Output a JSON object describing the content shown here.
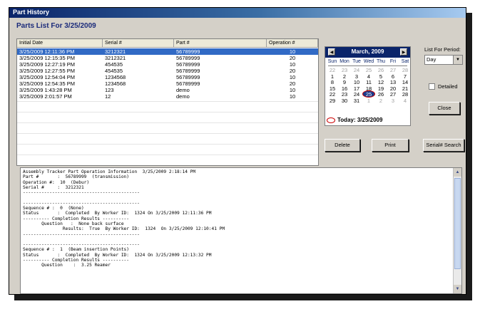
{
  "window": {
    "title": "Part History"
  },
  "heading": "Parts List For 3/25/2009",
  "grid": {
    "columns": [
      "Initial Date",
      "Serial #",
      "Part #",
      "Operation #"
    ],
    "rows": [
      [
        "3/25/2009 12:11:36 PM",
        "3212321",
        "56789999",
        "10"
      ],
      [
        "3/25/2009 12:15:35 PM",
        "3212321",
        "56789999",
        "20"
      ],
      [
        "3/25/2009 12:27:19 PM",
        "454535",
        "56789999",
        "10"
      ],
      [
        "3/25/2009 12:27:55 PM",
        "454535",
        "56789999",
        "20"
      ],
      [
        "3/25/2009 12:54:04 PM",
        "1234568",
        "56789999",
        "10"
      ],
      [
        "3/25/2009 12:54:35 PM",
        "1234568",
        "56789999",
        "20"
      ],
      [
        "3/25/2009 1:43:28 PM",
        "123",
        "demo",
        "10"
      ],
      [
        "3/25/2009 2:01:57 PM",
        "12",
        "demo",
        "10"
      ]
    ]
  },
  "calendar": {
    "prev_icon": "left-triangle-icon",
    "next_icon": "right-triangle-icon",
    "month_title": "March, 2009",
    "days_of_week": [
      "Sun",
      "Mon",
      "Tue",
      "Wed",
      "Thu",
      "Fri",
      "Sat"
    ],
    "weeks": [
      [
        "22",
        "23",
        "24",
        "25",
        "26",
        "27",
        "28"
      ],
      [
        "1",
        "2",
        "3",
        "4",
        "5",
        "6",
        "7"
      ],
      [
        "8",
        "9",
        "10",
        "11",
        "12",
        "13",
        "14"
      ],
      [
        "15",
        "16",
        "17",
        "18",
        "19",
        "20",
        "21"
      ],
      [
        "22",
        "23",
        "24",
        "25",
        "26",
        "27",
        "28"
      ],
      [
        "29",
        "30",
        "31",
        "1",
        "2",
        "3",
        "4"
      ]
    ],
    "today_label": "Today: 3/25/2009"
  },
  "period": {
    "label": "List For Period:",
    "value": "Day"
  },
  "detailed_label": "Detailed",
  "buttons": {
    "close": "Close",
    "delete": "Delete",
    "print": "Print",
    "serial_search": "Serial# Search"
  },
  "log_lines": [
    "Assembly Tracker Part Operation Information  3/25/2009 2:18:14 PM",
    "Part #       :  56789999  (transmission)",
    "Operation #:  10  (Debur)",
    "Serial #     :  3212321",
    "--------------------------------------------",
    "",
    "--------------------------------------------",
    "Sequence # :  0  (None)",
    "Status       :  Completed  By Worker ID:  1324 On 3/25/2009 12:11:36 PM",
    "---------- Completion Results ----------",
    "       Question   :  None back surface",
    "               Results:  True  By Worker ID:  1324  On 3/25/2009 12:10:41 PM",
    "--------------------------------------------",
    "",
    "--------------------------------------------",
    "Sequence # :  1  (Beam insertion Points)",
    "Status       :  Completed  By Worker ID:  1324 On 3/25/2009 12:13:32 PM",
    "---------- Completion Results ----------",
    "       Question    :  3.25 Reamer"
  ],
  "colors": {
    "title_bar": "#0a246a",
    "selection": "#316ac5",
    "heading": "#1a2a7a",
    "today_ring": "#cc0000"
  }
}
